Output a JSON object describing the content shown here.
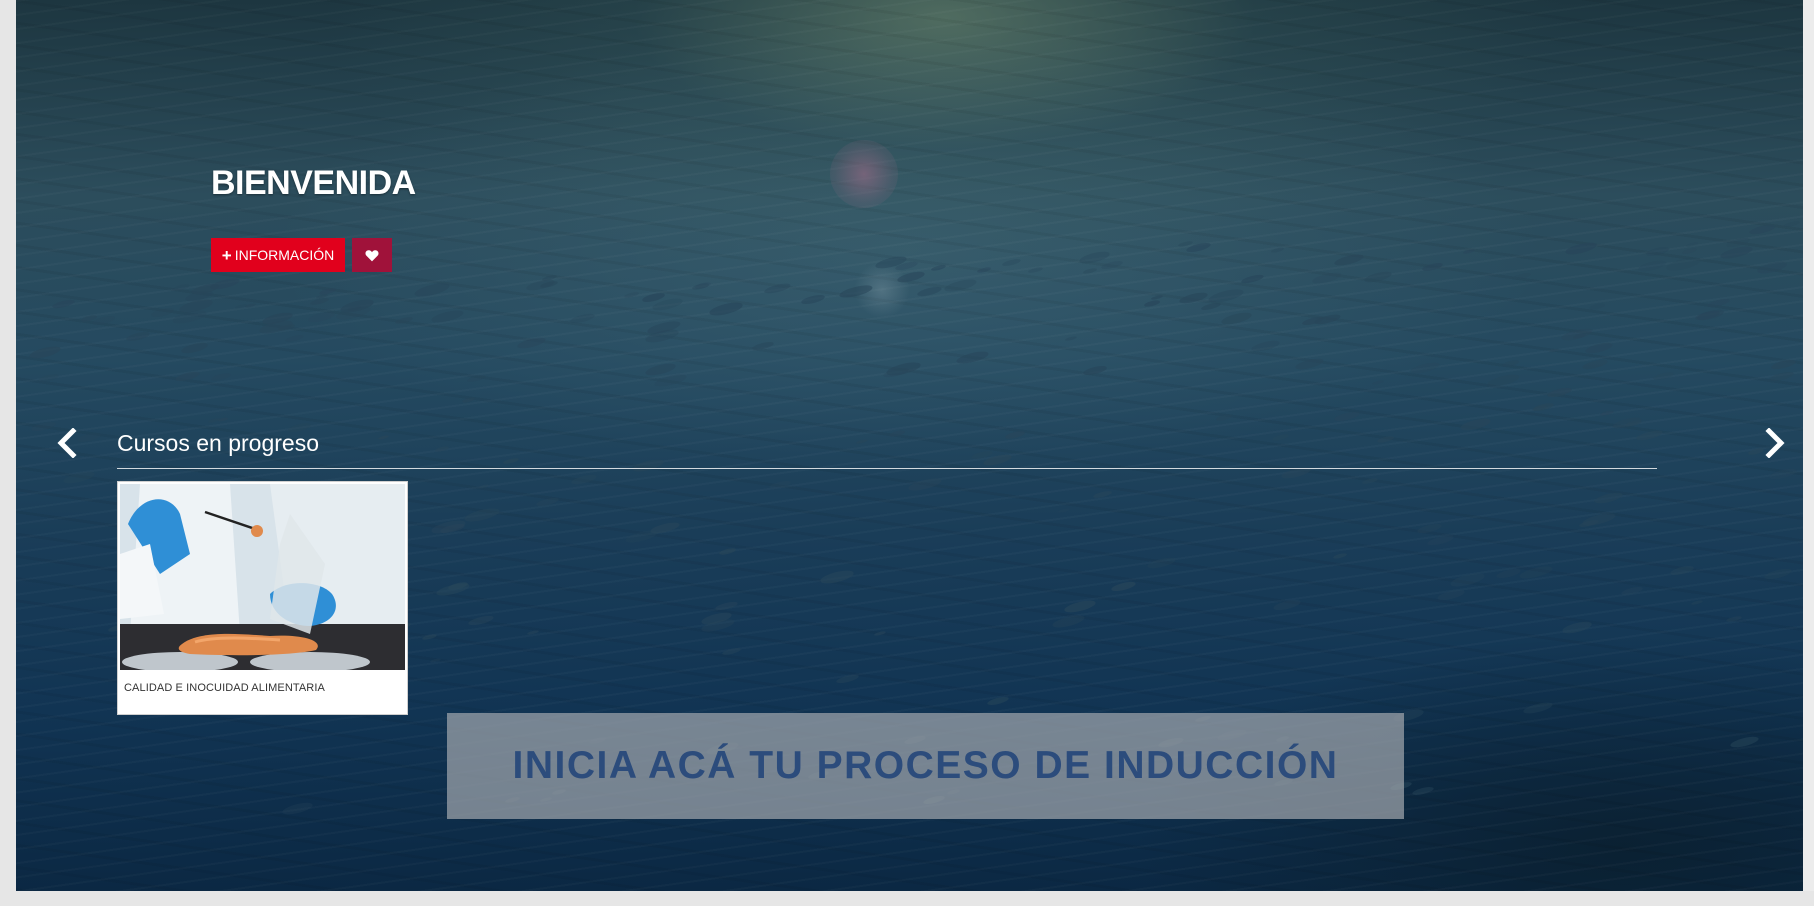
{
  "hero": {
    "title": "BIENVENIDA",
    "info_button_label": "INFORMACIÓN",
    "info_icon": "plus-icon",
    "favorite_icon": "heart-icon"
  },
  "carousel": {
    "section_title": "Cursos en progreso",
    "prev_icon": "chevron-left-icon",
    "next_icon": "chevron-right-icon",
    "courses": [
      {
        "title": "CALIDAD E INOCUIDAD ALIMENTARIA"
      }
    ]
  },
  "banner": {
    "text": "INICIA ACÁ TU PROCESO DE INDUCCIÓN"
  },
  "colors": {
    "primary_red": "#e1001c",
    "favorite_crimson": "#a0123a",
    "banner_text": "#2c4c7c",
    "banner_bg": "#a0a5ac"
  }
}
